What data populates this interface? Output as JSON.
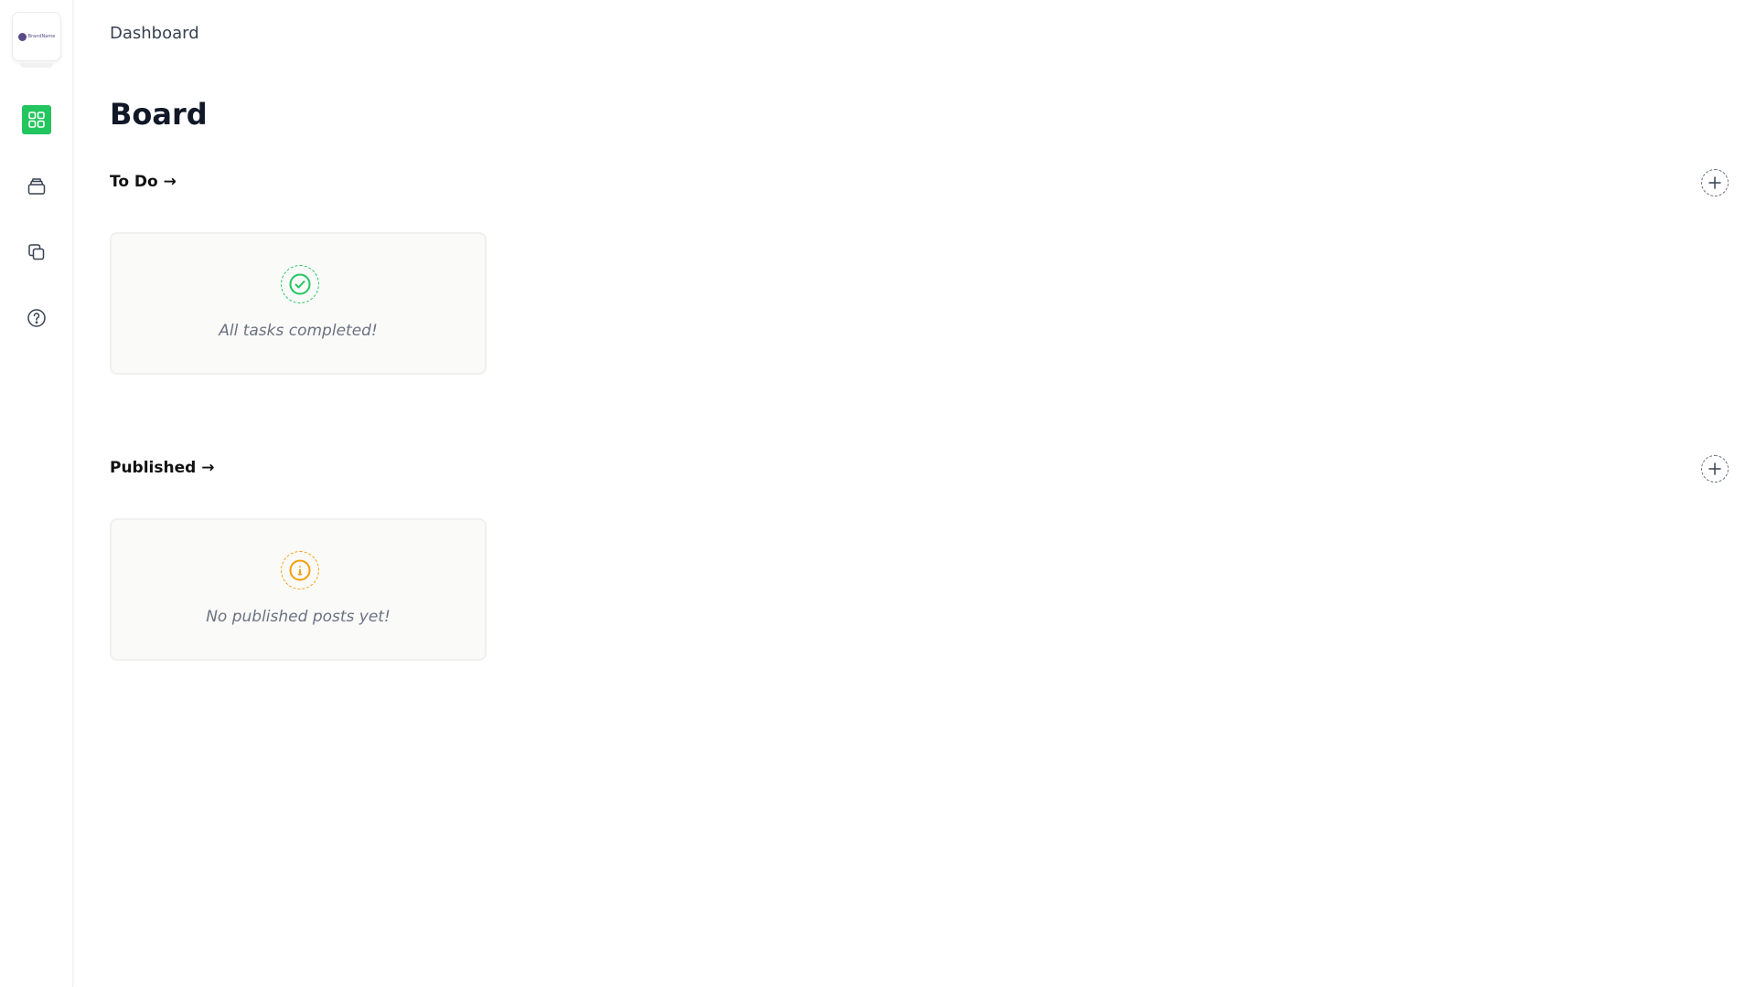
{
  "sidebar": {
    "logo_text": "BrandName",
    "items": [
      {
        "icon": "grid-icon",
        "active": true
      },
      {
        "icon": "inbox-icon",
        "active": false
      },
      {
        "icon": "copy-icon",
        "active": false
      },
      {
        "icon": "help-icon",
        "active": false
      }
    ]
  },
  "header": {
    "breadcrumb": "Dashboard",
    "title": "Board"
  },
  "sections": [
    {
      "title": "To Do →",
      "add_icon": "plus-icon",
      "empty_icon": "check-circle-icon",
      "empty_text": "All tasks completed!"
    },
    {
      "title": "Published →",
      "add_icon": "plus-icon",
      "empty_icon": "info-circle-icon",
      "empty_text": "No published posts yet!"
    }
  ],
  "colors": {
    "accent": "#22c55e",
    "warning": "#f59e0b",
    "muted_text": "#6b7280"
  }
}
